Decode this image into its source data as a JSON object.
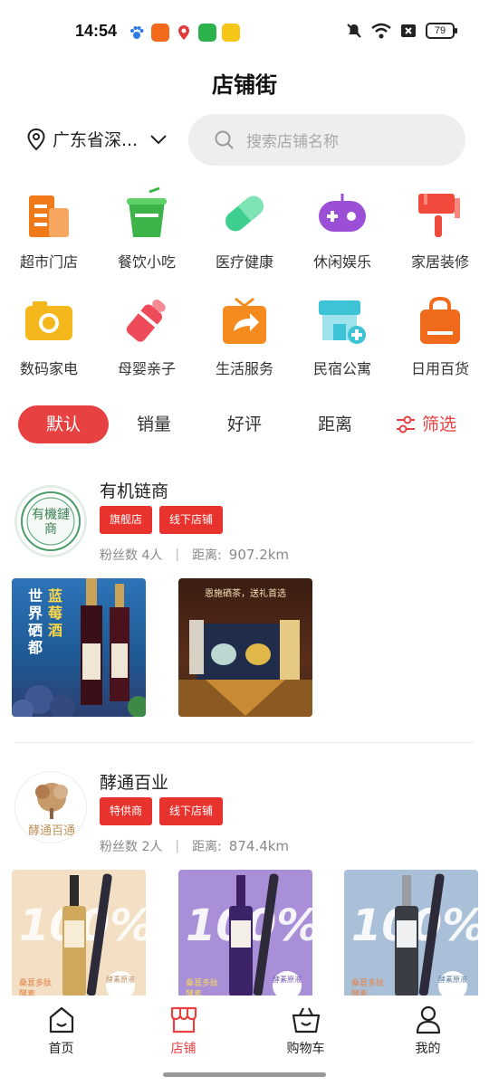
{
  "status_bar": {
    "time": "14:54",
    "battery": "79"
  },
  "header": {
    "title": "店铺街"
  },
  "location": {
    "label": "广东省深..."
  },
  "search": {
    "placeholder": "搜索店铺名称"
  },
  "categories": [
    {
      "label": "超市门店",
      "icon": "supermarket-icon",
      "color": "#f07a1a"
    },
    {
      "label": "餐饮小吃",
      "icon": "drink-cup-icon",
      "color": "#3cb44a"
    },
    {
      "label": "医疗健康",
      "icon": "pill-icon",
      "color": "#3ecf8e"
    },
    {
      "label": "休闲娱乐",
      "icon": "gamepad-icon",
      "color": "#9b4fd6"
    },
    {
      "label": "家居装修",
      "icon": "paint-brush-icon",
      "color": "#ef4a3c"
    },
    {
      "label": "数码家电",
      "icon": "camera-icon",
      "color": "#f5b81c"
    },
    {
      "label": "母婴亲子",
      "icon": "baby-bottle-icon",
      "color": "#ee4b5a"
    },
    {
      "label": "生活服务",
      "icon": "share-box-icon",
      "color": "#f58b1f"
    },
    {
      "label": "民宿公寓",
      "icon": "house-plus-icon",
      "color": "#3cc3d6"
    },
    {
      "label": "日用百货",
      "icon": "shopping-bag-icon",
      "color": "#f06a1c"
    }
  ],
  "sort_tabs": {
    "default": "默认",
    "sales": "销量",
    "rating": "好评",
    "distance": "距离",
    "filter": "筛选"
  },
  "stores": [
    {
      "name": "有机链商",
      "logo_text": "有機鏈商",
      "tags": [
        "旗舰店",
        "线下店铺"
      ],
      "fans_label": "粉丝数 4人",
      "distance_label": "距离:",
      "distance_value": "907.2km",
      "products": [
        {
          "text_a": "世界硒都",
          "text_b": "蓝莓酒"
        },
        {
          "banner": "恩施硒茶，送礼首选"
        }
      ]
    },
    {
      "name": "酵通百业",
      "logo_text": "酵通百通",
      "tags": [
        "特供商",
        "线下店铺"
      ],
      "fans_label": "粉丝数 2人",
      "distance_label": "距离:",
      "distance_value": "874.4km",
      "products": [
        {
          "big": "100%",
          "sub": "桑葚多肽酵素",
          "badge": "酵素原液"
        },
        {
          "big": "100%",
          "sub": "桑葚多肽酵素",
          "badge": "酵素原液"
        },
        {
          "big": "100%",
          "sub": "桑葚多肽酵素",
          "badge": "酵素原液"
        }
      ]
    }
  ],
  "bottom_nav": [
    {
      "label": "首页",
      "icon": "home-icon"
    },
    {
      "label": "店铺",
      "icon": "store-icon",
      "active": true
    },
    {
      "label": "购物车",
      "icon": "cart-basket-icon"
    },
    {
      "label": "我的",
      "icon": "user-icon"
    }
  ],
  "colors": {
    "accent": "#e84141",
    "tag": "#e8322e"
  }
}
